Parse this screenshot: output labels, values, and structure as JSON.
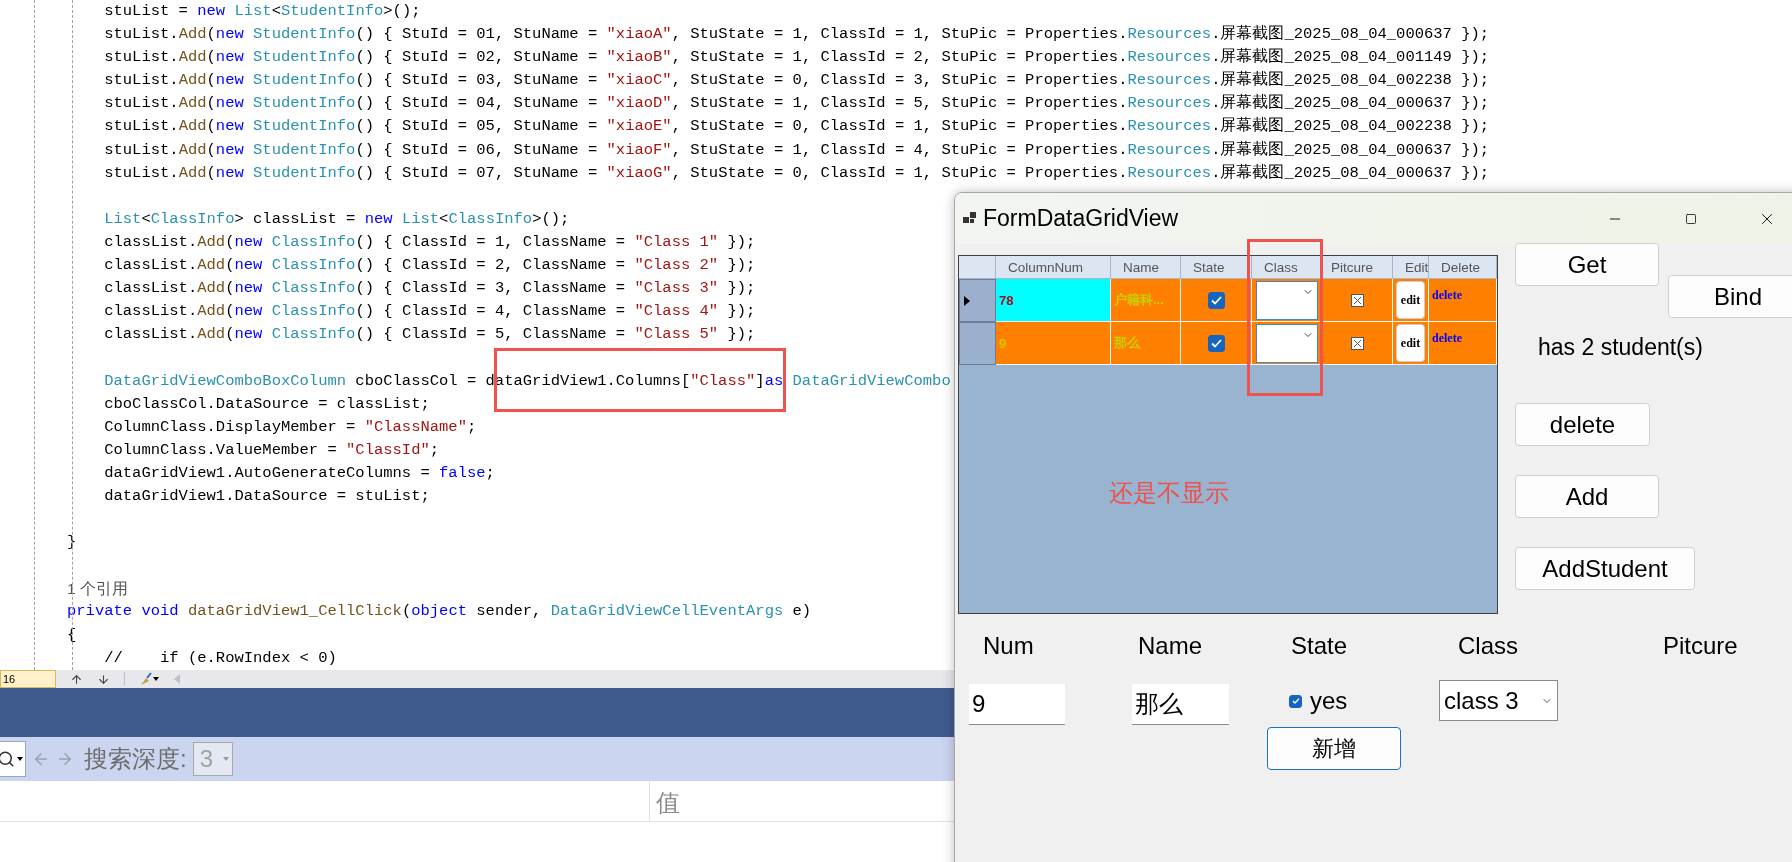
{
  "editor": {
    "blocks": [
      {
        "lines": [
          [
            {
              "kind": "plain",
              "text": "    stuList = "
            },
            {
              "kind": "keyword",
              "text": "new"
            },
            {
              "kind": "type",
              "text": " List"
            },
            {
              "kind": "plain",
              "text": "<"
            },
            {
              "kind": "type",
              "text": "StudentInfo"
            },
            {
              "kind": "plain",
              "text": ">();"
            }
          ],
          [
            {
              "kind": "plain",
              "text": "    stuList."
            },
            {
              "kind": "method",
              "text": "Add"
            },
            {
              "kind": "plain",
              "text": "("
            },
            {
              "kind": "keyword",
              "text": "new"
            },
            {
              "kind": "type",
              "text": " StudentInfo"
            },
            {
              "kind": "plain",
              "text": "() { StuId = 01, StuName = "
            },
            {
              "kind": "string",
              "text": "\"xiaoA\""
            },
            {
              "kind": "plain",
              "text": ", StuState = 1, ClassId = 1, StuPic = Properties."
            },
            {
              "kind": "type",
              "text": "Resources"
            },
            {
              "kind": "plain",
              "text": ".屏幕截图_2025_08_04_000637 });"
            }
          ],
          [
            {
              "kind": "plain",
              "text": "    stuList."
            },
            {
              "kind": "method",
              "text": "Add"
            },
            {
              "kind": "plain",
              "text": "("
            },
            {
              "kind": "keyword",
              "text": "new"
            },
            {
              "kind": "type",
              "text": " StudentInfo"
            },
            {
              "kind": "plain",
              "text": "() { StuId = 02, StuName = "
            },
            {
              "kind": "string",
              "text": "\"xiaoB\""
            },
            {
              "kind": "plain",
              "text": ", StuState = 1, ClassId = 2, StuPic = Properties."
            },
            {
              "kind": "type",
              "text": "Resources"
            },
            {
              "kind": "plain",
              "text": ".屏幕截图_2025_08_04_001149 });"
            }
          ],
          [
            {
              "kind": "plain",
              "text": "    stuList."
            },
            {
              "kind": "method",
              "text": "Add"
            },
            {
              "kind": "plain",
              "text": "("
            },
            {
              "kind": "keyword",
              "text": "new"
            },
            {
              "kind": "type",
              "text": " StudentInfo"
            },
            {
              "kind": "plain",
              "text": "() { StuId = 03, StuName = "
            },
            {
              "kind": "string",
              "text": "\"xiaoC\""
            },
            {
              "kind": "plain",
              "text": ", StuState = 0, ClassId = 3, StuPic = Properties."
            },
            {
              "kind": "type",
              "text": "Resources"
            },
            {
              "kind": "plain",
              "text": ".屏幕截图_2025_08_04_002238 });"
            }
          ],
          [
            {
              "kind": "plain",
              "text": "    stuList."
            },
            {
              "kind": "method",
              "text": "Add"
            },
            {
              "kind": "plain",
              "text": "("
            },
            {
              "kind": "keyword",
              "text": "new"
            },
            {
              "kind": "type",
              "text": " StudentInfo"
            },
            {
              "kind": "plain",
              "text": "() { StuId = 04, StuName = "
            },
            {
              "kind": "string",
              "text": "\"xiaoD\""
            },
            {
              "kind": "plain",
              "text": ", StuState = 1, ClassId = 5, StuPic = Properties."
            },
            {
              "kind": "type",
              "text": "Resources"
            },
            {
              "kind": "plain",
              "text": ".屏幕截图_2025_08_04_000637 });"
            }
          ],
          [
            {
              "kind": "plain",
              "text": "    stuList."
            },
            {
              "kind": "method",
              "text": "Add"
            },
            {
              "kind": "plain",
              "text": "("
            },
            {
              "kind": "keyword",
              "text": "new"
            },
            {
              "kind": "type",
              "text": " StudentInfo"
            },
            {
              "kind": "plain",
              "text": "() { StuId = 05, StuName = "
            },
            {
              "kind": "string",
              "text": "\"xiaoE\""
            },
            {
              "kind": "plain",
              "text": ", StuState = 0, ClassId = 1, StuPic = Properties."
            },
            {
              "kind": "type",
              "text": "Resources"
            },
            {
              "kind": "plain",
              "text": ".屏幕截图_2025_08_04_002238 });"
            }
          ],
          [
            {
              "kind": "plain",
              "text": "    stuList."
            },
            {
              "kind": "method",
              "text": "Add"
            },
            {
              "kind": "plain",
              "text": "("
            },
            {
              "kind": "keyword",
              "text": "new"
            },
            {
              "kind": "type",
              "text": " StudentInfo"
            },
            {
              "kind": "plain",
              "text": "() { StuId = 06, StuName = "
            },
            {
              "kind": "string",
              "text": "\"xiaoF\""
            },
            {
              "kind": "plain",
              "text": ", StuState = 1, ClassId = 4, StuPic = Properties."
            },
            {
              "kind": "type",
              "text": "Resources"
            },
            {
              "kind": "plain",
              "text": ".屏幕截图_2025_08_04_000637 });"
            }
          ],
          [
            {
              "kind": "plain",
              "text": "    stuList."
            },
            {
              "kind": "method",
              "text": "Add"
            },
            {
              "kind": "plain",
              "text": "("
            },
            {
              "kind": "keyword",
              "text": "new"
            },
            {
              "kind": "type",
              "text": " StudentInfo"
            },
            {
              "kind": "plain",
              "text": "() { StuId = 07, StuName = "
            },
            {
              "kind": "string",
              "text": "\"xiaoG\""
            },
            {
              "kind": "plain",
              "text": ", StuState = 0, ClassId = 1, StuPic = Properties."
            },
            {
              "kind": "type",
              "text": "Resources"
            },
            {
              "kind": "plain",
              "text": ".屏幕截图_2025_08_04_000637 });"
            }
          ]
        ]
      },
      {
        "lines": [
          [
            {
              "kind": "type",
              "text": "    List"
            },
            {
              "kind": "plain",
              "text": "<"
            },
            {
              "kind": "type",
              "text": "ClassInfo"
            },
            {
              "kind": "plain",
              "text": "> classList = "
            },
            {
              "kind": "keyword",
              "text": "new"
            },
            {
              "kind": "type",
              "text": " List"
            },
            {
              "kind": "plain",
              "text": "<"
            },
            {
              "kind": "type",
              "text": "ClassInfo"
            },
            {
              "kind": "plain",
              "text": ">();"
            }
          ],
          [
            {
              "kind": "plain",
              "text": "    classList."
            },
            {
              "kind": "method",
              "text": "Add"
            },
            {
              "kind": "plain",
              "text": "("
            },
            {
              "kind": "keyword",
              "text": "new"
            },
            {
              "kind": "type",
              "text": " ClassInfo"
            },
            {
              "kind": "plain",
              "text": "() { ClassId = 1, ClassName = "
            },
            {
              "kind": "string",
              "text": "\"Class 1\""
            },
            {
              "kind": "plain",
              "text": " });"
            }
          ],
          [
            {
              "kind": "plain",
              "text": "    classList."
            },
            {
              "kind": "method",
              "text": "Add"
            },
            {
              "kind": "plain",
              "text": "("
            },
            {
              "kind": "keyword",
              "text": "new"
            },
            {
              "kind": "type",
              "text": " ClassInfo"
            },
            {
              "kind": "plain",
              "text": "() { ClassId = 2, ClassName = "
            },
            {
              "kind": "string",
              "text": "\"Class 2\""
            },
            {
              "kind": "plain",
              "text": " });"
            }
          ],
          [
            {
              "kind": "plain",
              "text": "    classList."
            },
            {
              "kind": "method",
              "text": "Add"
            },
            {
              "kind": "plain",
              "text": "("
            },
            {
              "kind": "keyword",
              "text": "new"
            },
            {
              "kind": "type",
              "text": " ClassInfo"
            },
            {
              "kind": "plain",
              "text": "() { ClassId = 3, ClassName = "
            },
            {
              "kind": "string",
              "text": "\"Class 3\""
            },
            {
              "kind": "plain",
              "text": " });"
            }
          ],
          [
            {
              "kind": "plain",
              "text": "    classList."
            },
            {
              "kind": "method",
              "text": "Add"
            },
            {
              "kind": "plain",
              "text": "("
            },
            {
              "kind": "keyword",
              "text": "new"
            },
            {
              "kind": "type",
              "text": " ClassInfo"
            },
            {
              "kind": "plain",
              "text": "() { ClassId = 4, ClassName = "
            },
            {
              "kind": "string",
              "text": "\"Class 4\""
            },
            {
              "kind": "plain",
              "text": " });"
            }
          ],
          [
            {
              "kind": "plain",
              "text": "    classList."
            },
            {
              "kind": "method",
              "text": "Add"
            },
            {
              "kind": "plain",
              "text": "("
            },
            {
              "kind": "keyword",
              "text": "new"
            },
            {
              "kind": "type",
              "text": " ClassInfo"
            },
            {
              "kind": "plain",
              "text": "() { ClassId = 5, ClassName = "
            },
            {
              "kind": "string",
              "text": "\"Class 5\""
            },
            {
              "kind": "plain",
              "text": " });"
            }
          ]
        ]
      },
      {
        "lines": [
          [
            {
              "kind": "type",
              "text": "    DataGridViewComboBoxColumn"
            },
            {
              "kind": "plain",
              "text": " cboClassCol = dataGridView1.Columns["
            },
            {
              "kind": "string",
              "text": "\"Class\""
            },
            {
              "kind": "plain",
              "text": "]"
            },
            {
              "kind": "keyword",
              "text": "as"
            },
            {
              "kind": "type",
              "text": " DataGridViewCombo"
            }
          ],
          [
            {
              "kind": "plain",
              "text": "    cboClassCol.DataSource = classList;"
            }
          ],
          [
            {
              "kind": "plain",
              "text": "    ColumnClass.DisplayMember = "
            },
            {
              "kind": "string",
              "text": "\"ClassName\""
            },
            {
              "kind": "plain",
              "text": ";"
            }
          ],
          [
            {
              "kind": "plain",
              "text": "    ColumnClass.ValueMember = "
            },
            {
              "kind": "string",
              "text": "\"ClassId\""
            },
            {
              "kind": "plain",
              "text": ";"
            }
          ],
          [
            {
              "kind": "plain",
              "text": "    dataGridView1.AutoGenerateColumns = "
            },
            {
              "kind": "keyword",
              "text": "false"
            },
            {
              "kind": "plain",
              "text": ";"
            }
          ],
          [
            {
              "kind": "plain",
              "text": "    dataGridView1.DataSource = stuList;"
            }
          ]
        ]
      },
      {
        "lines": [
          [
            {
              "kind": "plain",
              "text": "}"
            }
          ]
        ]
      },
      {
        "lines": [
          [
            {
              "kind": "hint",
              "text": "1 个引用"
            }
          ],
          [
            {
              "kind": "keyword",
              "text": "private void"
            },
            {
              "kind": "method",
              "text": " dataGridView1_CellClick"
            },
            {
              "kind": "plain",
              "text": "("
            },
            {
              "kind": "keyword",
              "text": "object"
            },
            {
              "kind": "plain",
              "text": " sender, "
            },
            {
              "kind": "type",
              "text": "DataGridViewCellEventArgs"
            },
            {
              "kind": "plain",
              "text": " e)"
            }
          ],
          [
            {
              "kind": "plain",
              "text": "{"
            }
          ],
          [
            {
              "kind": "plain",
              "text": "    //    if (e.RowIndex < 0)"
            }
          ]
        ]
      }
    ]
  },
  "editor_toolbar": {
    "line_number": "16"
  },
  "search_toolbar": {
    "depth_label": "搜索深度:",
    "depth_value": "3"
  },
  "values_table": {
    "column_header": "值"
  },
  "form": {
    "title": "FormDataGridView",
    "grid": {
      "columns": [
        "ColumnNum",
        "Name",
        "State",
        "Class",
        "Pitcure",
        "Edit",
        "Delete"
      ],
      "rows": [
        {
          "selected": true,
          "num": "78",
          "highlighted": true,
          "name": "户籍科...",
          "state_checked": true,
          "edit": "edit",
          "delete": "delete"
        },
        {
          "selected": false,
          "num": "9",
          "highlighted": false,
          "name": "那么",
          "state_checked": true,
          "edit": "edit",
          "delete": "delete"
        }
      ]
    },
    "annotation": "还是不显示",
    "buttons": {
      "get": "Get",
      "bind": "Bind",
      "delete": "delete",
      "add": "Add",
      "add_student": "AddStudent"
    },
    "count_label": "has 2 student(s)",
    "entry": {
      "labels": [
        "Num",
        "Name",
        "State",
        "Class",
        "Pitcure"
      ],
      "num": "9",
      "name": "那么",
      "state": {
        "checked": true,
        "label": "yes"
      },
      "class": "class 3",
      "submit": "新增"
    }
  }
}
